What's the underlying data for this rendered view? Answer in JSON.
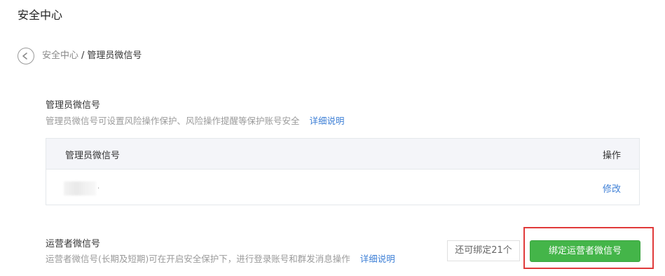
{
  "header": {
    "title": "安全中心"
  },
  "breadcrumb": {
    "parent": "安全中心",
    "separator": "/",
    "current": "管理员微信号"
  },
  "admin_section": {
    "title": "管理员微信号",
    "description": "管理员微信号可设置风险操作保护、风险操作提醒等保护账号安全",
    "detail_link": "详细说明",
    "table": {
      "columns": [
        "管理员微信号",
        "操作"
      ],
      "rows": [
        {
          "wechat_id": "",
          "action": "修改"
        }
      ]
    }
  },
  "operator_section": {
    "title": "运营者微信号",
    "description": "运营者微信号(长期及短期)可在开启安全保护下，进行登录账号和群发消息操作",
    "detail_link": "详细说明",
    "quota_text": "还可绑定21个",
    "bind_button": "绑定运营者微信号"
  },
  "colors": {
    "accent_link": "#3d7fd6",
    "primary_button": "#44b549",
    "highlight_border": "#e03a3a"
  },
  "icons": {
    "back": "chevron-left-circle-icon"
  }
}
